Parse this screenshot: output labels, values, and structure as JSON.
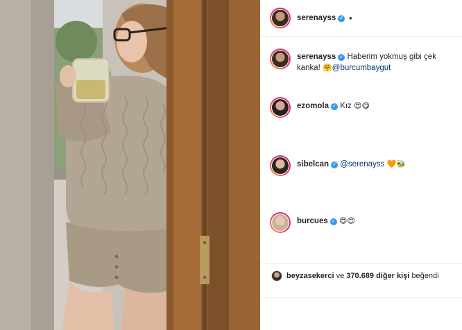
{
  "post": {
    "author": "serenayss",
    "header_separator": "•"
  },
  "comments": [
    {
      "user": "serenayss",
      "text": "Haberim yokmuş gibi çek kanka! ",
      "emoji": "🤗",
      "mention": "@burcumbaygut"
    },
    {
      "user": "ezomola",
      "text": "Kız",
      "emoji": "😍😋",
      "mention": ""
    },
    {
      "user": "sibelcan",
      "text": "",
      "emoji": "🧡🐝",
      "mention": "@serenayss"
    },
    {
      "user": "burcues",
      "text": "",
      "emoji": "😍😍",
      "mention": ""
    }
  ],
  "likes": {
    "first_user": "beyzasekerci",
    "connector": "ve",
    "count_text": "370.689 diğer kişi",
    "suffix": "beğendi"
  },
  "colors": {
    "verified": "#3897f0",
    "mention": "#00376b",
    "ring_start": "#f9a13a",
    "ring_end": "#c13584"
  }
}
